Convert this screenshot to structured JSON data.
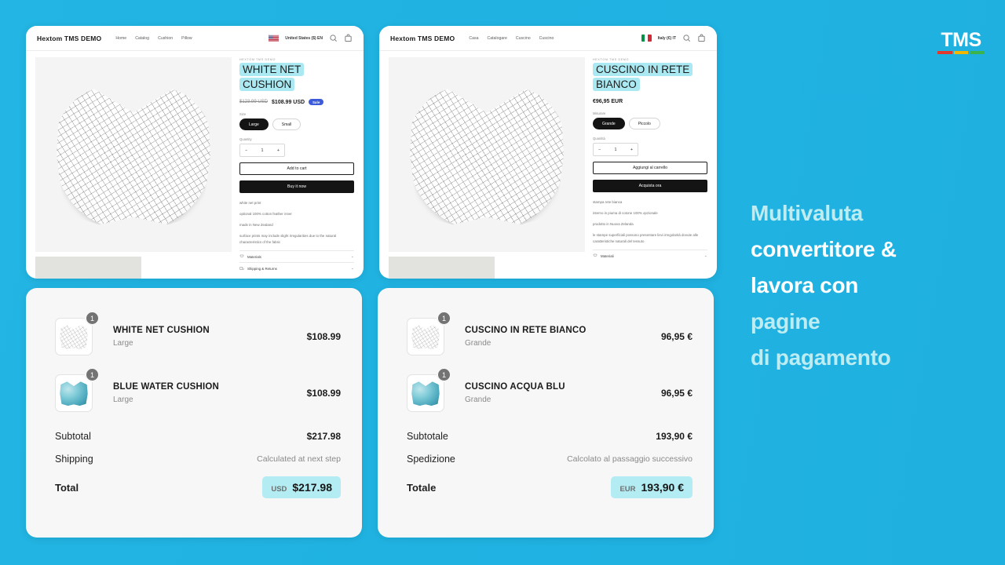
{
  "background_color": "#21b2e1",
  "logo": {
    "word": "TMS",
    "bar_colors": [
      "#e03a2f",
      "#f2b705",
      "#3cb44b"
    ]
  },
  "promo": {
    "lines": [
      {
        "text": "Multivaluta",
        "tone": "a"
      },
      {
        "text": "convertitore &",
        "tone": "b"
      },
      {
        "text": "lavora con",
        "tone": "b"
      },
      {
        "text": "pagine",
        "tone": "a"
      },
      {
        "text": "di pagamento",
        "tone": "a"
      }
    ]
  },
  "product_en": {
    "shop_name": "Hextom TMS DEMO",
    "nav": [
      "Home",
      "Catalog",
      "Cushion",
      "Pillow"
    ],
    "locale": "United States ($) EN",
    "flag": "us-flag-icon",
    "eyebrow": "HEXTOM TMS DEMO",
    "title": "WHITE NET CUSHION",
    "price_old": "$123.99 USD",
    "price_now": "$108.99 USD",
    "sale_badge": "Sale",
    "size_label": "Size",
    "sizes": [
      "Large",
      "Small"
    ],
    "size_selected": "Large",
    "qty_label": "Quantity",
    "qty_value": "1",
    "qty_minus": "−",
    "qty_plus": "+",
    "add_to_cart": "Add to cart",
    "buy_now": "Buy it now",
    "description": [
      "white net print",
      "optional 100% cotton feather inner",
      "made in New Zealand",
      "surface prints may include slight irregularities due to the natural characteristics of the fabric"
    ],
    "accordions": [
      {
        "label": "Materials",
        "icon": "materials-icon",
        "chevron": "⌄"
      },
      {
        "label": "Shipping & Returns",
        "icon": "shipping-icon",
        "chevron": "⌄"
      }
    ]
  },
  "product_it": {
    "shop_name": "Hextom TMS DEMO",
    "nav": [
      "Casa",
      "Catalogare",
      "Cuscino",
      "Cuscino"
    ],
    "locale": "Italy (€) IT",
    "flag": "it-flag-icon",
    "eyebrow": "HEXTOM TMS DEMO",
    "title": "CUSCINO IN RETE BIANCO",
    "price_now": "€96,95 EUR",
    "size_label": "Misurare",
    "sizes": [
      "Grande",
      "Piccolo"
    ],
    "size_selected": "Grande",
    "qty_label": "Quantità",
    "qty_value": "1",
    "qty_minus": "−",
    "qty_plus": "+",
    "add_to_cart": "Aggiungi al carrello",
    "buy_now": "Acquista ora",
    "description": [
      "stampa rete bianca",
      "interno in piuma di cotone 100% opzionale",
      "prodotto in Nuova Zelanda",
      "le stampe superficiali possono presentare lievi irregolarità dovute alle caratteristiche naturali del tessuto"
    ],
    "accordions": [
      {
        "label": "Materiali",
        "icon": "materials-icon",
        "chevron": "⌄"
      }
    ]
  },
  "cart_en": {
    "items": [
      {
        "qty": "1",
        "name": "WHITE NET CUSHION",
        "variant": "Large",
        "price": "$108.99",
        "swatch": "white"
      },
      {
        "qty": "1",
        "name": "BLUE WATER CUSHION",
        "variant": "Large",
        "price": "$108.99",
        "swatch": "blue"
      }
    ],
    "subtotal_label": "Subtotal",
    "subtotal_value": "$217.98",
    "shipping_label": "Shipping",
    "shipping_value": "Calculated at next step",
    "total_label": "Total",
    "total_currency": "USD",
    "total_value": "$217.98"
  },
  "cart_it": {
    "items": [
      {
        "qty": "1",
        "name": "CUSCINO IN RETE BIANCO",
        "variant": "Grande",
        "price": "96,95 €",
        "swatch": "white"
      },
      {
        "qty": "1",
        "name": "CUSCINO ACQUA BLU",
        "variant": "Grande",
        "price": "96,95 €",
        "swatch": "blue"
      }
    ],
    "subtotal_label": "Subtotale",
    "subtotal_value": "193,90 €",
    "shipping_label": "Spedizione",
    "shipping_value": "Calcolato al passaggio successivo",
    "total_label": "Totale",
    "total_currency": "EUR",
    "total_value": "193,90 €"
  }
}
